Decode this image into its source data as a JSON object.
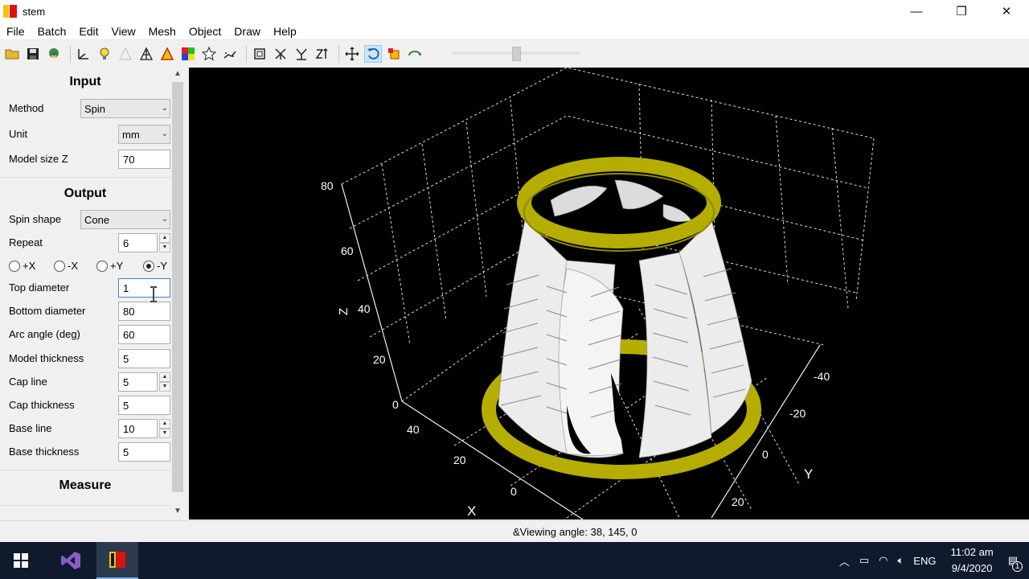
{
  "window": {
    "title": "stem",
    "minimize": "—",
    "restore": "❐",
    "close": "✕"
  },
  "menu": [
    "File",
    "Batch",
    "Edit",
    "View",
    "Mesh",
    "Object",
    "Draw",
    "Help"
  ],
  "toolbar": {
    "icons": [
      "open-folder-icon",
      "save-icon",
      "batch-icon",
      "axes-icon",
      "light-bulb-icon",
      "wireframe-icon",
      "mesh-icon",
      "color-mesh-icon",
      "palette-icon",
      "star-icon",
      "points-icon",
      "bounding-box-icon",
      "view-x-icon",
      "view-y-icon",
      "view-z-icon",
      "move-icon",
      "rotate-icon",
      "scale-icon",
      "flip-icon"
    ],
    "zoom_level": 0.5
  },
  "panel": {
    "input_title": "Input",
    "method_label": "Method",
    "method_value": "Spin",
    "unit_label": "Unit",
    "unit_value": "mm",
    "model_size_label": "Model size Z",
    "model_size_value": "70",
    "output_title": "Output",
    "spin_shape_label": "Spin shape",
    "spin_shape_value": "Cone",
    "repeat_label": "Repeat",
    "repeat_value": "6",
    "radios": [
      {
        "label": "+X",
        "checked": false
      },
      {
        "label": "-X",
        "checked": false
      },
      {
        "label": "+Y",
        "checked": false
      },
      {
        "label": "-Y",
        "checked": true
      }
    ],
    "top_diameter_label": "Top diameter",
    "top_diameter_value": "1",
    "bottom_diameter_label": "Bottom diameter",
    "bottom_diameter_value": "80",
    "arc_angle_label": "Arc angle (deg)",
    "arc_angle_value": "60",
    "model_thickness_label": "Model thickness",
    "model_thickness_value": "5",
    "cap_line_label": "Cap line",
    "cap_line_value": "5",
    "cap_thickness_label": "Cap thickness",
    "cap_thickness_value": "5",
    "base_line_label": "Base line",
    "base_line_value": "10",
    "base_thickness_label": "Base thickness",
    "base_thickness_value": "5",
    "measure_title": "Measure"
  },
  "viewport": {
    "z_ticks": [
      "80",
      "60",
      "40",
      "20",
      "0"
    ],
    "x_ticks": [
      "40",
      "20",
      "0"
    ],
    "y_ticks": [
      "-40",
      "-20",
      "0",
      "20"
    ],
    "x_label": "X",
    "y_label": "Y",
    "z_label": "Z",
    "ring_color": "#b5ad00",
    "blade_color": "#ececec"
  },
  "status": {
    "text": "&Viewing angle: 38, 145, 0"
  },
  "taskbar": {
    "lang": "ENG",
    "time": "11:02 am",
    "date": "9/4/2020",
    "notification_count": "1"
  }
}
